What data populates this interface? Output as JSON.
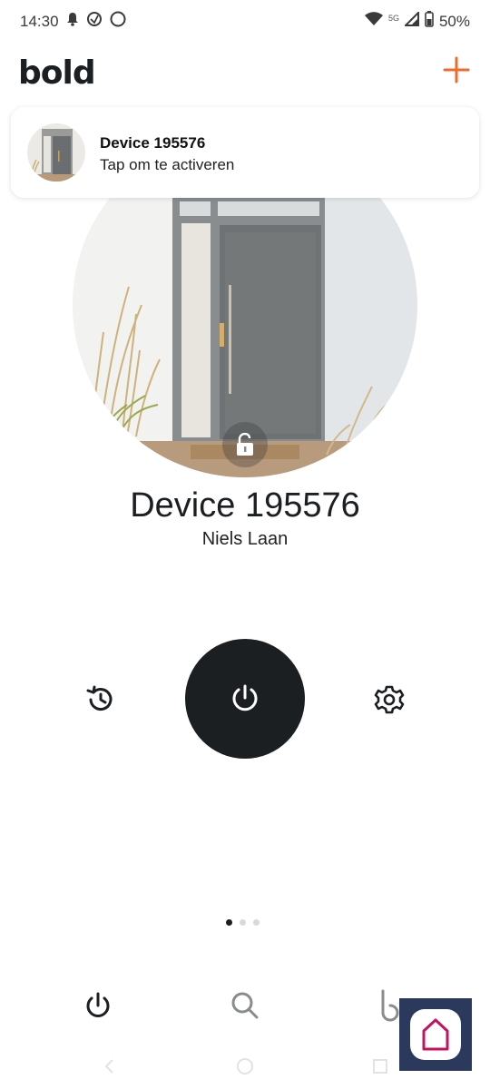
{
  "status_bar": {
    "time": "14:30",
    "network": "5G",
    "battery": "50%"
  },
  "header": {
    "logo": "bold",
    "accent_color": "#f06a2b"
  },
  "activation_card": {
    "title": "Device 195576",
    "subtitle": "Tap om te activeren"
  },
  "device": {
    "name": "Device 195576",
    "location": "Niels Laan",
    "lock_icon": "unlocked-lock-icon"
  },
  "controls": {
    "left_icon": "history-icon",
    "center_icon": "power-icon",
    "right_icon": "gear-icon",
    "center_color": "#1b1f22"
  },
  "pagination": {
    "current_page": 1,
    "total_pages": 3
  },
  "bottom_nav": {
    "items": [
      "power-icon",
      "search-icon",
      "bold-icon"
    ]
  }
}
